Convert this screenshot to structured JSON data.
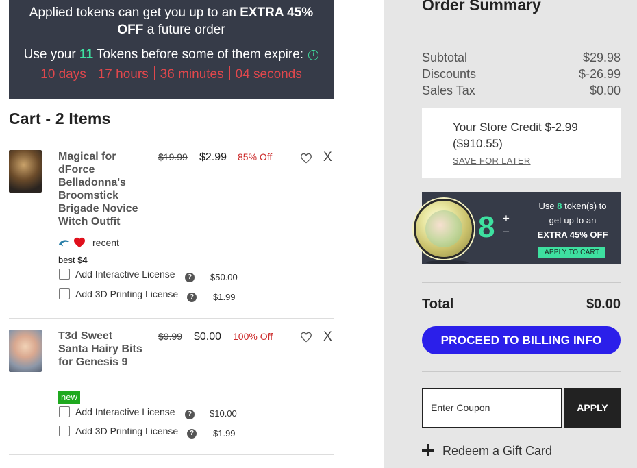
{
  "promo": {
    "line1_prefix": "Applied tokens can get you up to an ",
    "line1_bold": "EXTRA 45%",
    "line1_bold2": "OFF",
    "line1_suffix": " a future order",
    "line2_prefix": "Use your ",
    "line2_tokens": "11",
    "line2_suffix": " Tokens before some of them expire:",
    "countdown": [
      "10 days",
      "17 hours",
      "36 minutes",
      "04 seconds"
    ]
  },
  "cart": {
    "title": "Cart - 2 Items",
    "items": [
      {
        "name": "Magical for dForce Belladonna's Broomstick Brigade Novice Witch Outfit",
        "old_price": "$19.99",
        "price": "$2.99",
        "discount": "85% Off",
        "remove": "X",
        "recent": "recent",
        "best_prefix": "best ",
        "best_value": "$4",
        "licenses": [
          {
            "label": "Add Interactive License",
            "price": "$50.00"
          },
          {
            "label": "Add 3D Printing License",
            "price": "$1.99"
          }
        ]
      },
      {
        "name": "T3d Sweet Santa Hairy Bits for Genesis 9",
        "old_price": "$9.99",
        "price": "$0.00",
        "discount": "100% Off",
        "remove": "X",
        "badge": "new",
        "licenses": [
          {
            "label": "Add Interactive License",
            "price": "$10.00"
          },
          {
            "label": "Add 3D Printing License",
            "price": "$1.99"
          }
        ]
      }
    ]
  },
  "summary": {
    "title": "Order Summary",
    "rows": [
      {
        "label": "Subtotal",
        "value": "$29.98"
      },
      {
        "label": "Discounts",
        "value": "$-26.99"
      },
      {
        "label": "Sales Tax",
        "value": "$0.00"
      }
    ],
    "store_credit": "Your Store Credit $-2.99 ($910.55)",
    "save_for_later": "SAVE FOR LATER",
    "tokens": {
      "count": "8",
      "plus": "+",
      "minus": "−",
      "msg_prefix": "Use ",
      "msg_count": "8",
      "msg_suffix": " token(s) to get up to an",
      "msg_bold": "EXTRA 45% OFF",
      "apply_label": "APPLY TO CART"
    },
    "total_label": "Total",
    "total_value": "$0.00",
    "proceed_label": "PROCEED TO BILLING INFO",
    "coupon_placeholder": "Enter Coupon",
    "apply_label": "APPLY",
    "gift_label": "Redeem a Gift Card"
  },
  "colors": {
    "promo_bg": "#363b48",
    "accent_green": "#3ee0a0",
    "countdown_red": "#e0474c",
    "discount_red": "#cc2a2a",
    "proceed_blue": "#2b1fea",
    "new_badge_green": "#1fa91f"
  },
  "icons": [
    "info-icon",
    "heart-icon",
    "close-icon",
    "dolphin-icon",
    "help-icon",
    "token-coin-icon",
    "plus-icon"
  ]
}
